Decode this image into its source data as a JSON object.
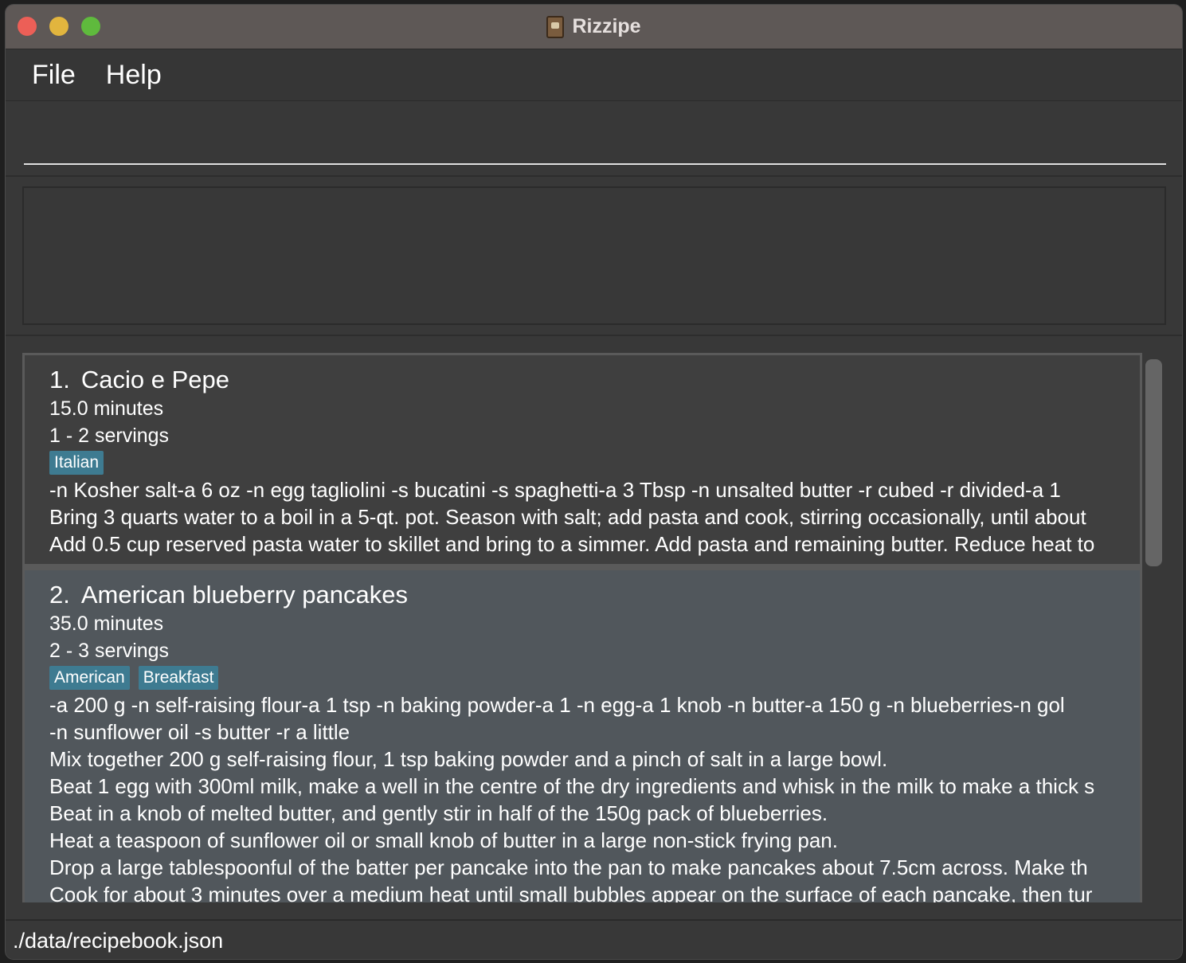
{
  "window": {
    "title": "Rizzipe"
  },
  "menu": {
    "items": [
      "File",
      "Help"
    ]
  },
  "command_box": {
    "value": "",
    "placeholder": ""
  },
  "result_display": {
    "text": ""
  },
  "recipes": [
    {
      "index": "1.",
      "name": "Cacio e Pepe",
      "duration": "15.0 minutes",
      "servings": "1 - 2 servings",
      "tags": [
        "Italian"
      ],
      "lines": [
        "-n Kosher salt-a 6 oz -n egg tagliolini -s bucatini -s spaghetti-a 3 Tbsp -n unsalted butter -r cubed -r divided-a 1",
        "Bring 3 quarts water to a boil in a 5-qt. pot. Season with salt; add pasta and cook, stirring occasionally, until about",
        "Add 0.5 cup reserved pasta water to skillet and bring to a simmer. Add pasta and remaining butter. Reduce heat to"
      ]
    },
    {
      "index": "2.",
      "name": "American blueberry pancakes",
      "duration": "35.0 minutes",
      "servings": "2 - 3 servings",
      "tags": [
        "American",
        "Breakfast"
      ],
      "lines": [
        "-a 200 g -n self-raising flour-a 1 tsp -n baking powder-a 1 -n egg-a 1 knob -n butter-a 150 g -n blueberries-n gol",
        "-n sunflower oil -s butter -r a little",
        "Mix together 200 g self-raising flour, 1 tsp baking powder and a pinch of salt in a large bowl.",
        "Beat 1 egg with 300ml milk, make a well in the centre of the dry ingredients and whisk in the milk to make a thick s",
        "Beat in a knob of melted butter, and gently stir in half of the 150g pack of blueberries.",
        "Heat a teaspoon of sunflower oil or small knob of butter in a large non-stick frying pan.",
        "Drop a large tablespoonful of the batter per pancake into the pan to make pancakes about 7.5cm across. Make th",
        "Cook for about 3 minutes over a medium heat until small bubbles appear on the surface of each pancake, then tur"
      ]
    }
  ],
  "status": {
    "file_path": "./data/recipebook.json"
  },
  "colors": {
    "tag": "#3e7b91",
    "close": "#ec5f57",
    "minimize": "#e2b53e",
    "zoom": "#5fba3d"
  },
  "icons": {
    "app": "recipe-book-icon"
  }
}
